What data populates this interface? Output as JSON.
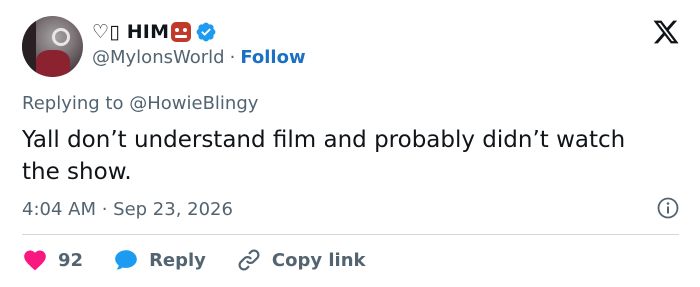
{
  "author": {
    "display_name": "♡▯ HIM",
    "handle": "@MylonsWorld",
    "separator": "·",
    "follow_label": "Follow"
  },
  "reply_context": {
    "prefix": "Replying to",
    "mention": "@HowieBlingy"
  },
  "tweet": {
    "text": "Yall don’t understand film and probably didn’t watch the show.",
    "timestamp": "4:04 AM · Sep 23, 2026"
  },
  "actions": {
    "like_count": "92",
    "reply_label": "Reply",
    "copy_label": "Copy link"
  },
  "colors": {
    "like": "#f91880",
    "reply": "#1d9bf0",
    "verified": "#1d9bf0",
    "follow": "#1d6fc4"
  },
  "icons": {
    "brand": "x-logo-icon",
    "verified": "verified-badge-icon",
    "info": "info-icon",
    "like": "heart-icon",
    "reply": "speech-bubble-icon",
    "copy": "link-icon"
  }
}
